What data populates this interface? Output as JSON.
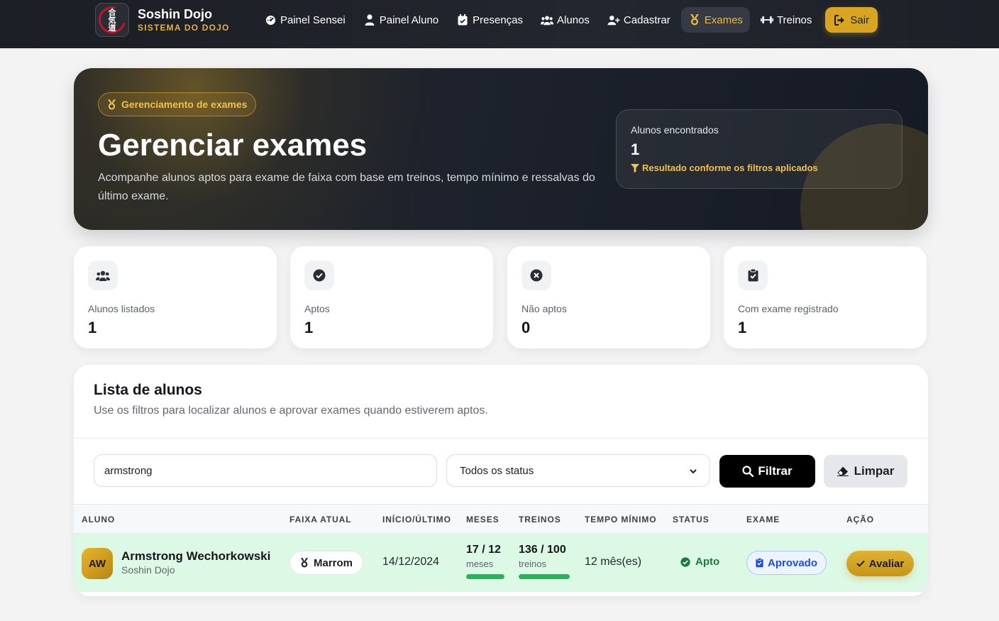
{
  "brand": {
    "name": "Soshin Dojo",
    "subtitle": "SISTEMA DO DOJO",
    "logo_kanji": [
      "合",
      "気",
      "道"
    ]
  },
  "nav": {
    "items": [
      {
        "label": "Painel Sensei",
        "icon": "gauge-icon"
      },
      {
        "label": "Painel Aluno",
        "icon": "user-icon"
      },
      {
        "label": "Presenças",
        "icon": "clipboard-check-icon"
      },
      {
        "label": "Alunos",
        "icon": "users-icon"
      },
      {
        "label": "Cadastrar",
        "icon": "user-plus-icon"
      },
      {
        "label": "Exames",
        "icon": "medal-icon",
        "active": true
      },
      {
        "label": "Treinos",
        "icon": "dumbbell-icon"
      }
    ],
    "logout_label": "Sair"
  },
  "hero": {
    "badge": "Gerenciamento de exames",
    "title": "Gerenciar exames",
    "description": "Acompanhe alunos aptos para exame de faixa com base em treinos, tempo mínimo e ressalvas do último exame.",
    "card": {
      "label": "Alunos encontrados",
      "value": "1",
      "note": "Resultado conforme os filtros aplicados"
    }
  },
  "stats": [
    {
      "label": "Alunos listados",
      "value": "1",
      "icon": "users-icon"
    },
    {
      "label": "Aptos",
      "value": "1",
      "icon": "check-circle-icon"
    },
    {
      "label": "Não aptos",
      "value": "0",
      "icon": "x-circle-icon"
    },
    {
      "label": "Com exame registrado",
      "value": "1",
      "icon": "clipboard-check-icon"
    }
  ],
  "list": {
    "title": "Lista de alunos",
    "subtitle": "Use os filtros para localizar alunos e aprovar exames quando estiverem aptos.",
    "search_value": "armstrong",
    "status_select": "Todos os status",
    "filter_label": "Filtrar",
    "clear_label": "Limpar",
    "columns": [
      "ALUNO",
      "FAIXA ATUAL",
      "INÍCIO/ÚLTIMO",
      "MESES",
      "TREINOS",
      "TEMPO MÍNIMO",
      "STATUS",
      "EXAME",
      "AÇÃO"
    ],
    "rows": [
      {
        "initials": "AW",
        "name": "Armstrong Wechorkowski",
        "dojo": "Soshin Dojo",
        "belt": "Marrom",
        "date": "14/12/2024",
        "months": "17 / 12",
        "months_unit": "meses",
        "months_progress": 1.0,
        "trainings": "136 / 100",
        "trainings_unit": "treinos",
        "trainings_progress": 1.0,
        "min_time": "12 mês(es)",
        "status": "Apto",
        "exam": "Aprovado",
        "action": "Avaliar"
      }
    ]
  },
  "colors": {
    "accent": "#d9a520",
    "dark": "#1b1e24",
    "success": "#22b559",
    "row_bg": "#dcf9e6",
    "exam_blue": "#1f4ed8"
  }
}
